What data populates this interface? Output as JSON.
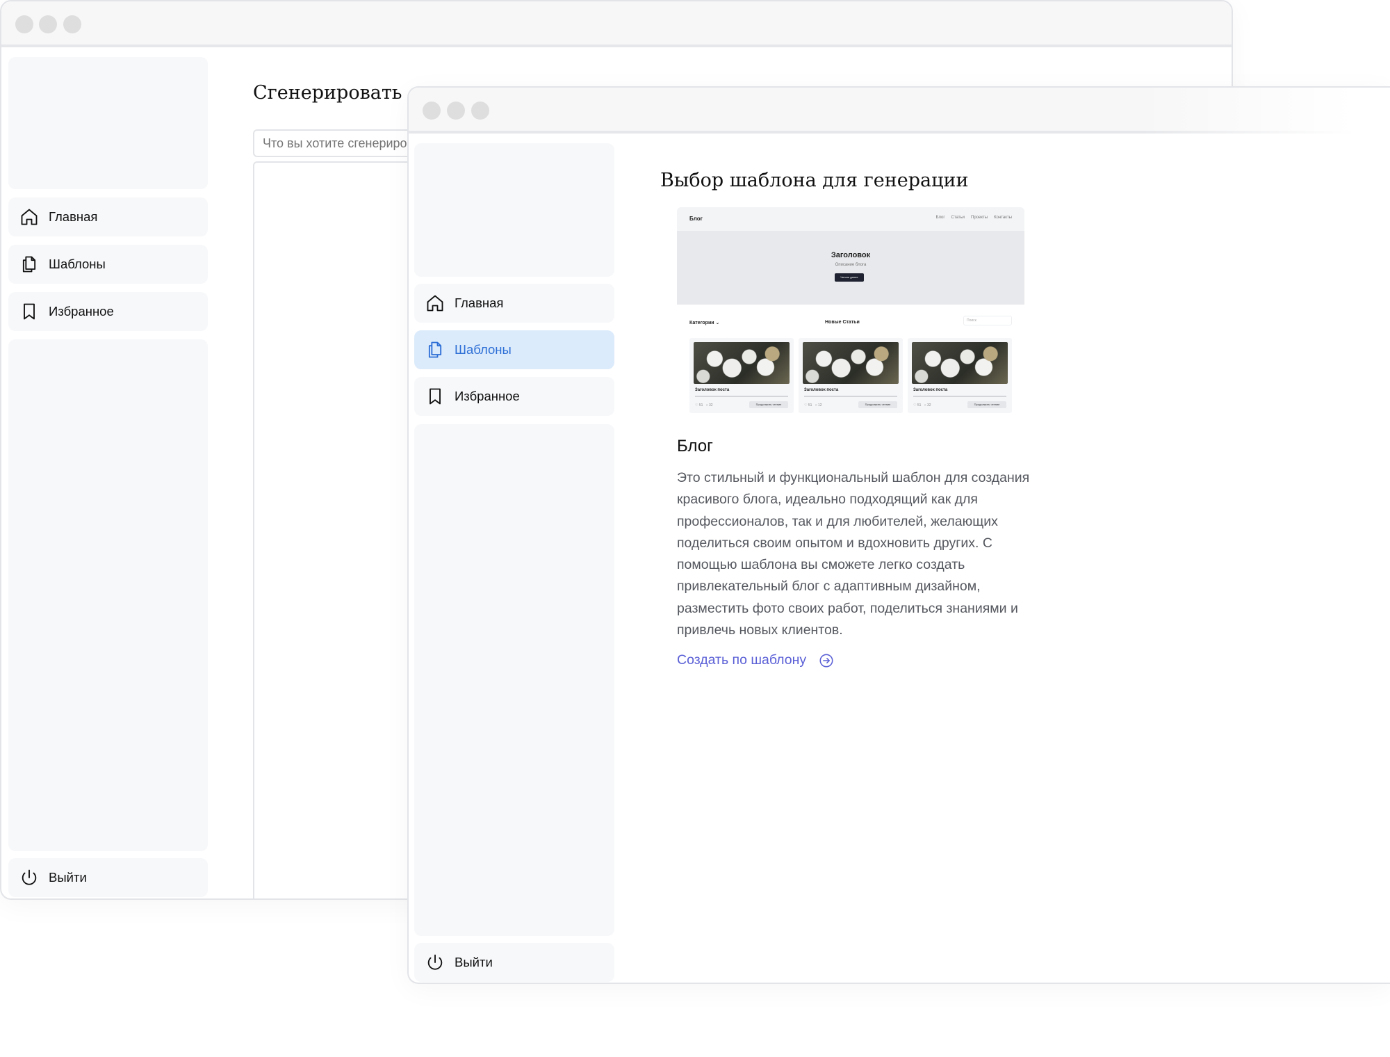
{
  "back_window": {
    "title": "Сгенерировать",
    "input_placeholder": "Что вы хотите сгенерировать?",
    "nav": {
      "home": "Главная",
      "templates": "Шаблоны",
      "favorites": "Избранное",
      "logout": "Выйти"
    }
  },
  "front_window": {
    "title": "Выбор шаблона для генерации",
    "nav": {
      "home": "Главная",
      "templates": "Шаблоны",
      "favorites": "Избранное",
      "logout": "Выйти",
      "active": "templates"
    },
    "template": {
      "name": "Блог",
      "description": "Это стильный и функциональный шаблон для создания красивого блога, идеально подходящий как для профессионалов, так и для любителей, желающих поделиться своим опытом и вдохновить других. С помощью шаблона вы сможете легко создать привлекательный блог с адаптивным дизайном, разместить фото своих работ, поделиться знаниями и привлечь новых клиентов.",
      "action_label": "Создать по шаблону",
      "preview": {
        "brand": "Блог",
        "nav_links": [
          "Блог",
          "Статьи",
          "Проекты",
          "Контакты"
        ],
        "hero_title": "Заголовок",
        "hero_subtitle": "Описание блога",
        "hero_button": "Читать далее",
        "categories_label": "Категории",
        "new_articles_label": "Новые Статьи",
        "search_placeholder": "Поиск",
        "cards": [
          {
            "title": "Заголовок поста",
            "likes": "51",
            "comments": "32",
            "button": "Продолжить чтение"
          },
          {
            "title": "Заголовок поста",
            "likes": "51",
            "comments": "12",
            "button": "Продолжить чтение"
          },
          {
            "title": "Заголовок поста",
            "likes": "51",
            "comments": "32",
            "button": "Продолжить чтение"
          }
        ]
      }
    }
  },
  "colors": {
    "accent": "#2d6fd6",
    "active_nav_bg": "#dcebfb",
    "link": "#5a5fd6",
    "panel_bg": "#f7f8fa"
  }
}
